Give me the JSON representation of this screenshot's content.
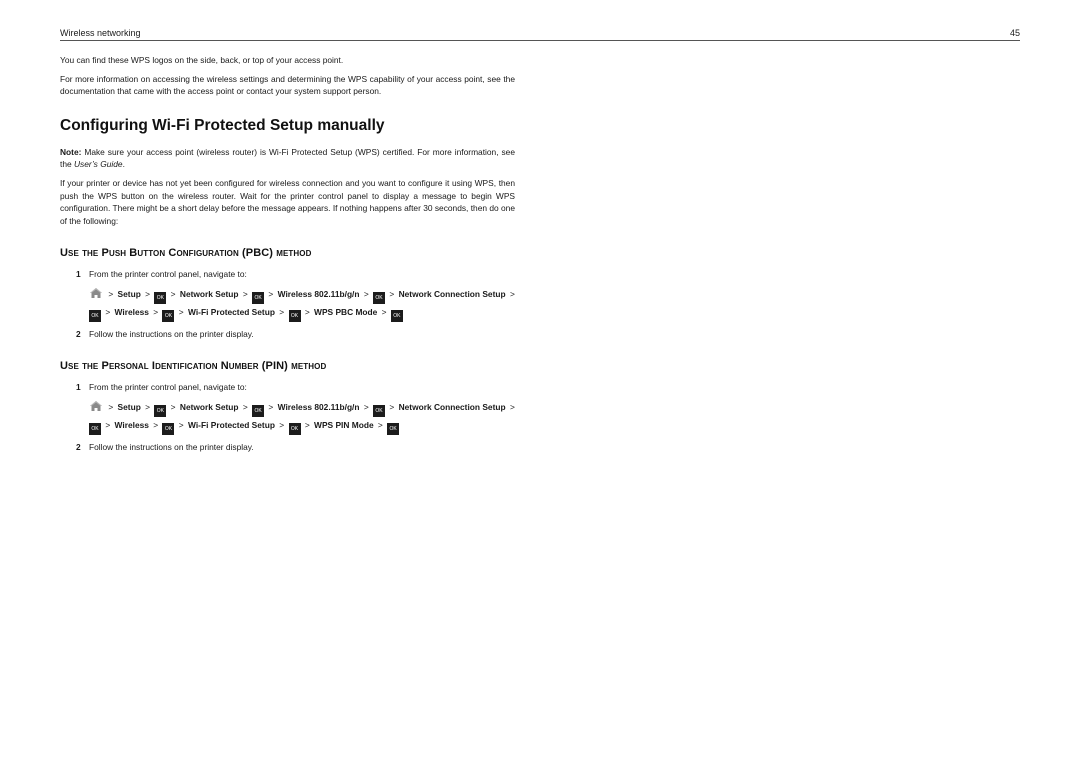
{
  "header": {
    "running_title": "Wireless networking",
    "page_number": "45"
  },
  "intro": {
    "paragraph1": "You can find these WPS logos on the side, back, or top of your access point.",
    "paragraph2": "For more information on accessing the wireless settings and determining the WPS capability of your access point, see the documentation that came with the access point or contact your system support person."
  },
  "section": {
    "title": "Configuring Wi‑Fi Protected Setup manually",
    "note_label": "Note:",
    "note_text_before": " Make sure your access point (wireless router) is Wi‑Fi Protected Setup (WPS) certified. For more information, see the ",
    "note_italic": "User’s Guide",
    "note_text_after": ".",
    "body": "If your printer or device has not yet been configured for wireless connection and you want to configure it using WPS, then push the WPS button on the wireless router. Wait for the printer control panel to display a message to begin WPS configuration. There might be a short delay before the message appears. If nothing happens after 30 seconds, then do one of the following:"
  },
  "icons": {
    "home": "home-icon",
    "ok": "ok-button-icon"
  },
  "ok_label": "OK",
  "separator": ">",
  "methods": [
    {
      "heading": "Use the Push Button Configuration (PBC) method",
      "steps": [
        {
          "number": "1",
          "text": "From the printer control panel, navigate to:"
        },
        {
          "number": "2",
          "text": "Follow the instructions on the printer display."
        }
      ],
      "path": [
        "Setup",
        "Network Setup",
        "Wireless 802.11b/g/n",
        "Network Connection Setup",
        "Wireless",
        "Wi‑Fi Protected Setup",
        "WPS PBC Mode"
      ]
    },
    {
      "heading": "Use the Personal Identification Number (PIN) method",
      "steps": [
        {
          "number": "1",
          "text": "From the printer control panel, navigate to:"
        },
        {
          "number": "2",
          "text": "Follow the instructions on the printer display."
        }
      ],
      "path": [
        "Setup",
        "Network Setup",
        "Wireless 802.11b/g/n",
        "Network Connection Setup",
        "Wireless",
        "Wi‑Fi Protected Setup",
        "WPS PIN Mode"
      ]
    }
  ]
}
